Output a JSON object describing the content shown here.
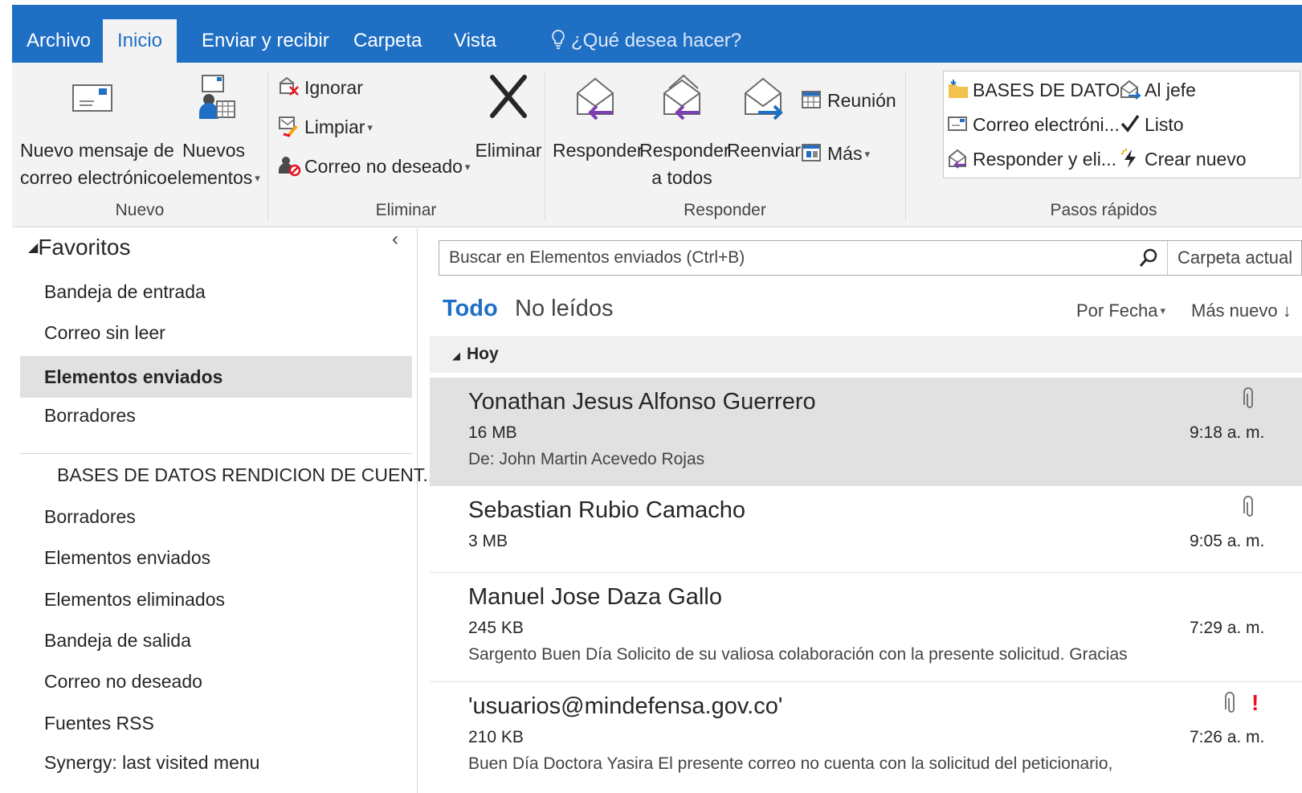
{
  "ribbon": {
    "tabs": [
      "Archivo",
      "Inicio",
      "Enviar y recibir",
      "Carpeta",
      "Vista"
    ],
    "active_tab": "Inicio",
    "tell_me": "¿Qué desea hacer?",
    "groups": {
      "nuevo": {
        "label": "Nuevo",
        "new_mail_line1": "Nuevo mensaje de",
        "new_mail_line2": "correo electrónico",
        "new_items_line1": "Nuevos",
        "new_items_line2": "elementos"
      },
      "eliminar": {
        "label": "Eliminar",
        "ignore": "Ignorar",
        "cleanup": "Limpiar",
        "junk": "Correo no deseado",
        "delete": "Eliminar"
      },
      "responder": {
        "label": "Responder",
        "reply": "Responder",
        "reply_all_line1": "Responder",
        "reply_all_line2": "a todos",
        "forward": "Reenviar",
        "meeting": "Reunión",
        "more": "Más"
      },
      "pasos": {
        "label": "Pasos rápidos",
        "items": [
          "BASES DE DATO...",
          "Al jefe",
          "Correo electróni...",
          "Listo",
          "Responder y eli...",
          "Crear nuevo"
        ]
      }
    }
  },
  "nav": {
    "collapse_glyph": "‹",
    "favorites_label": "Favoritos",
    "favorites": [
      "Bandeja de entrada",
      "Correo sin leer",
      "Elementos enviados",
      "Borradores"
    ],
    "selected": "Elementos enviados",
    "account": "BASES DE DATOS RENDICION DE CUENT...",
    "account_folders": [
      "Borradores",
      "Elementos enviados",
      "Elementos eliminados",
      "Bandeja de salida",
      "Correo no deseado",
      "Fuentes RSS",
      "Synergy: last visited menu"
    ]
  },
  "list": {
    "search_placeholder": "Buscar en Elementos enviados (Ctrl+B)",
    "scope": "Carpeta actual",
    "filter_all": "Todo",
    "filter_unread": "No leídos",
    "sort_by": "Por Fecha",
    "sort_order": "Más nuevo",
    "sort_arrow": "↓",
    "group_today": "Hoy",
    "messages": [
      {
        "sender": "Yonathan Jesus Alfonso Guerrero",
        "size": "16 MB",
        "preview": "De: John Martin Acevedo Rojas",
        "time": "9:18 a. m.",
        "attachment": true,
        "important": false
      },
      {
        "sender": "Sebastian Rubio Camacho",
        "size": "3 MB",
        "preview": "",
        "time": "9:05 a. m.",
        "attachment": true,
        "important": false
      },
      {
        "sender": "Manuel Jose Daza Gallo",
        "size": "245 KB",
        "preview": "Sargento  Buen Día   Solicito de su valiosa colaboración con la presente solicitud.  Gracias",
        "time": "7:29 a. m.",
        "attachment": false,
        "important": false
      },
      {
        "sender": "'usuarios@mindefensa.gov.co'",
        "size": "210 KB",
        "preview": "Buen Día Doctora Yasira   El presente correo no cuenta con la solicitud del peticionario,",
        "time": "7:26 a. m.",
        "attachment": true,
        "important": true
      }
    ]
  },
  "colors": {
    "accent": "#1f6fc5",
    "ribbon_bg": "#f3f3f3",
    "selection": "#e1e1e1",
    "important": "#e81123"
  }
}
